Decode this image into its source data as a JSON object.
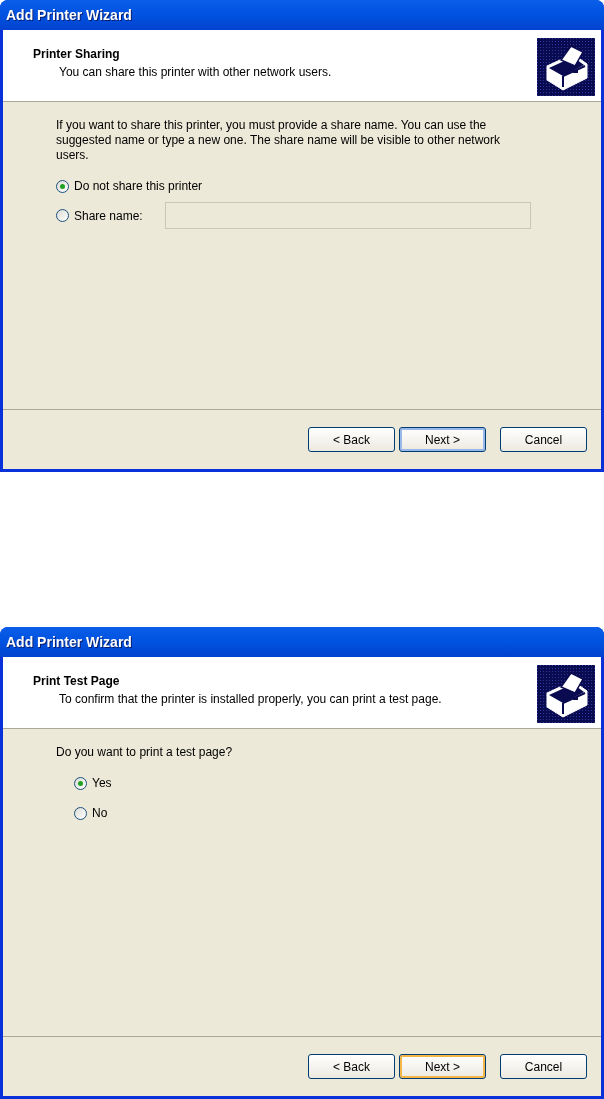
{
  "dialogs": [
    {
      "title": "Add Printer Wizard",
      "header": {
        "heading": "Printer Sharing",
        "subtitle": "You can share this printer with other network users."
      },
      "intro": "If you want to share this printer, you must provide a share name. You can use the suggested name or type a new one. The share name will be visible to other network users.",
      "indent": false,
      "options": [
        {
          "kind": "radio",
          "label": "Do not share this printer",
          "selected": true
        },
        {
          "kind": "radio_field",
          "label": "Share name:",
          "selected": false,
          "field_disabled": true
        }
      ],
      "buttons": [
        {
          "label": "< Back",
          "kind": "normal"
        },
        {
          "label": "Next >",
          "kind": "default"
        },
        {
          "label": "Cancel",
          "kind": "normal"
        }
      ]
    },
    {
      "title": "Add Printer Wizard",
      "header": {
        "heading": "Print Test Page",
        "subtitle": "To confirm that the printer is installed properly, you can print a test page."
      },
      "intro": "Do you want to print a test page?",
      "indent": true,
      "options": [
        {
          "kind": "radio",
          "label": "Yes",
          "selected": true
        },
        {
          "kind": "radio",
          "label": "No",
          "selected": false
        }
      ],
      "buttons": [
        {
          "label": "< Back",
          "kind": "normal"
        },
        {
          "label": "Next >",
          "kind": "hot"
        },
        {
          "label": "Cancel",
          "kind": "normal"
        }
      ]
    }
  ]
}
